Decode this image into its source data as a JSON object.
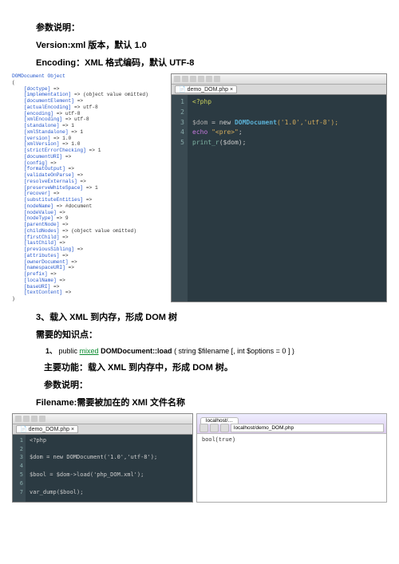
{
  "h_params": "参数说明：",
  "h_version": "Version:xml 版本，默认 1.0",
  "h_encoding": "Encoding：XML 格式编码，默认 UTF-8",
  "ide_tab": "demo_DOM.php",
  "dump_header": "DOMDocument Object",
  "dump_lines": [
    "[doctype] =>",
    "[implementation] => (object value omitted)",
    "[documentElement] =>",
    "[actualEncoding] => utf-8",
    "[encoding] => utf-8",
    "[xmlEncoding] => utf-8",
    "[standalone] => 1",
    "[xmlStandalone] => 1",
    "[version] => 1.0",
    "[xmlVersion] => 1.0",
    "[strictErrorChecking] => 1",
    "[documentURI] =>",
    "[config] =>",
    "[formatOutput] =>",
    "[validateOnParse] =>",
    "[resolveExternals] =>",
    "[preserveWhiteSpace] => 1",
    "[recover] =>",
    "[substituteEntities] =>",
    "[nodeName] => #document",
    "[nodeValue] =>",
    "[nodeType] => 9",
    "[parentNode] =>",
    "[childNodes] => (object value omitted)",
    "[firstChild] =>",
    "[lastChild] =>",
    "[previousSibling] =>",
    "[attributes] =>",
    "[ownerDocument] =>",
    "[namespaceURI] =>",
    "[prefix] =>",
    "[localName] =>",
    "[baseURI] =>",
    "[textContent] =>"
  ],
  "code1": {
    "l1": "<?php",
    "l2": "",
    "l3": {
      "var": "$dom",
      "op": " = new ",
      "cls": "DOMDocument",
      "args": "('1.0','utf-8');"
    },
    "l4": {
      "kw": "echo ",
      "str": "\"<pre>\"",
      "end": ";"
    },
    "l5": {
      "fn": "print_r",
      "args": "($dom);"
    }
  },
  "h_section3": "3、载入 XML 到内存，形成 DOM 树",
  "h_needs": "需要的知识点：",
  "sig_num": "1、",
  "sig_mod": "public ",
  "sig_mixed": "mixed",
  "sig_name": " DOMDocument::load",
  "sig_args": " ( string $filename [, int $options = 0 ] )",
  "h_main_fn": "主要功能：载入 XML 到内存中，形成 DOM 树。",
  "h_params2": "参数说明：",
  "h_filename": "Filename:需要被加在的 XMl 文件名称",
  "code2": {
    "l1": "<?php",
    "l2_var": "$dom",
    "l2_rest": " = new ",
    "l2_cls": "DOMDocument",
    "l2_args": "('1.0','utf-8');",
    "l3_var": "$bool",
    "l3_mid": " = $dom->",
    "l3_fn": "load",
    "l3_args": "('php_DOM.xml');",
    "l4_fn": "var_dump",
    "l4_args": "($bool);"
  },
  "browser_tab": "localhost/…",
  "browser_url": "localhost/demo_DOM.php",
  "browser_body": "bool(true)"
}
